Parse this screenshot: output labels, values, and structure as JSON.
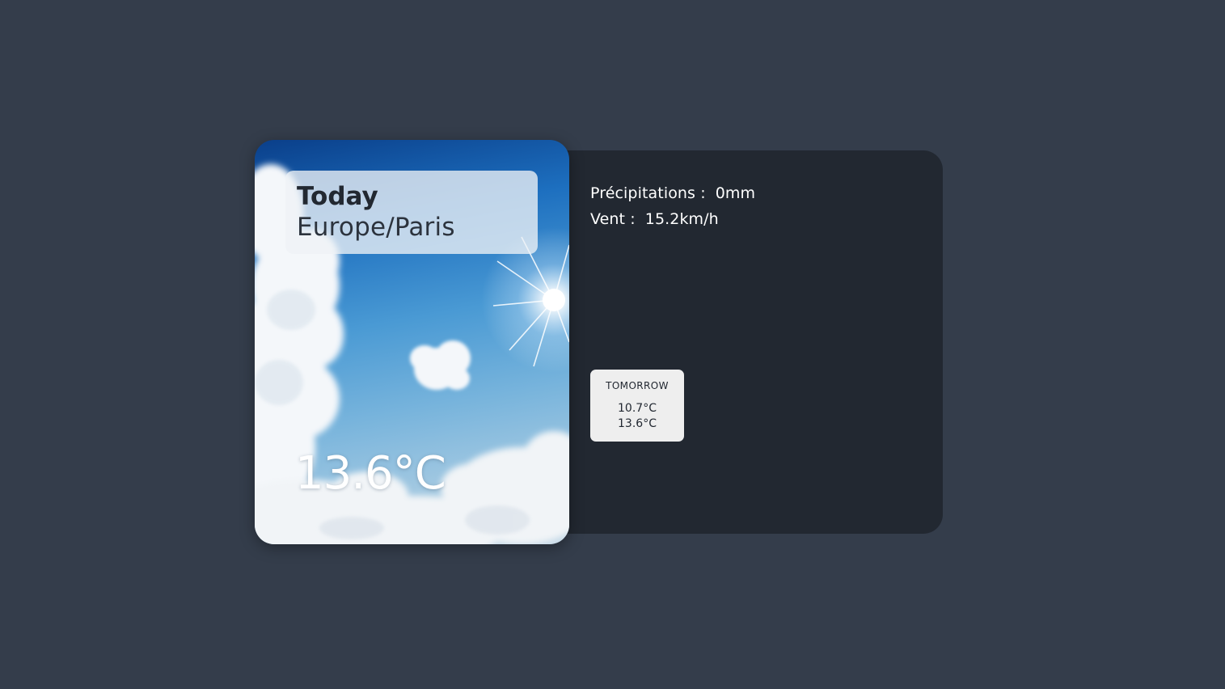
{
  "today": {
    "label": "Today",
    "timezone": "Europe/Paris",
    "temperature": "13.6°C"
  },
  "details": {
    "precipitation_label": "Précipitations :",
    "precipitation_value": "0mm",
    "wind_label": "Vent :",
    "wind_value": "15.2km/h"
  },
  "forecast": [
    {
      "day": "TOMORROW",
      "temp_min": "10.7°C",
      "temp_max": "13.6°C"
    }
  ],
  "colors": {
    "background": "#343d4b",
    "panel": "#222831",
    "card": "#eeeeee",
    "text_light": "#ffffff",
    "text_dark": "#222831"
  }
}
